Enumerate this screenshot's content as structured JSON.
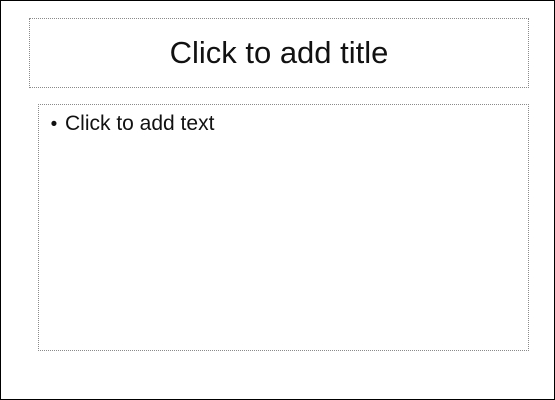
{
  "slide": {
    "title_placeholder": "Click to add title",
    "body_placeholder": {
      "bullet_char": "•",
      "text": "Click to add text"
    }
  }
}
